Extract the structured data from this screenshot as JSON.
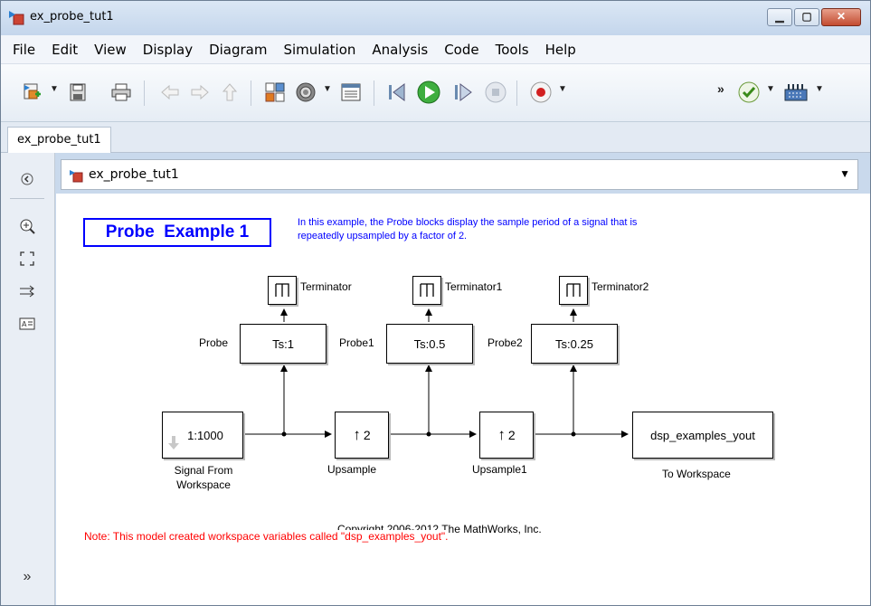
{
  "window": {
    "title": "ex_probe_tut1"
  },
  "menu": [
    "File",
    "Edit",
    "View",
    "Display",
    "Diagram",
    "Simulation",
    "Analysis",
    "Code",
    "Tools",
    "Help"
  ],
  "tab": {
    "label": "ex_probe_tut1"
  },
  "address": {
    "path": "ex_probe_tut1"
  },
  "toolbar": {
    "overflow": "»"
  },
  "palette": {
    "expand": "»"
  },
  "model": {
    "title": "Probe  Example 1",
    "description_line1": "In this example, the Probe blocks display the sample period of a signal that is",
    "description_line2": "repeatedly upsampled by a factor of 2.",
    "source": {
      "value": "1:1000",
      "label_line1": "Signal From",
      "label_line2": "Workspace"
    },
    "upsample1": {
      "value": "2",
      "label": "Upsample"
    },
    "upsample2": {
      "value": "2",
      "label": "Upsample1"
    },
    "sink": {
      "value": "dsp_examples_yout",
      "label": "To Workspace"
    },
    "probes": [
      {
        "label": "Probe",
        "value": "Ts:1"
      },
      {
        "label": "Probe1",
        "value": "Ts:0.5"
      },
      {
        "label": "Probe2",
        "value": "Ts:0.25"
      }
    ],
    "terminators": [
      "Terminator",
      "Terminator1",
      "Terminator2"
    ],
    "copyright": "Copyright 2006-2012 The MathWorks, Inc.",
    "note": "Note: This model created workspace variables called \"dsp_examples_yout\".",
    "colors": {
      "title": "#0000ff",
      "description": "#0000ff",
      "note": "#ff0000"
    }
  }
}
